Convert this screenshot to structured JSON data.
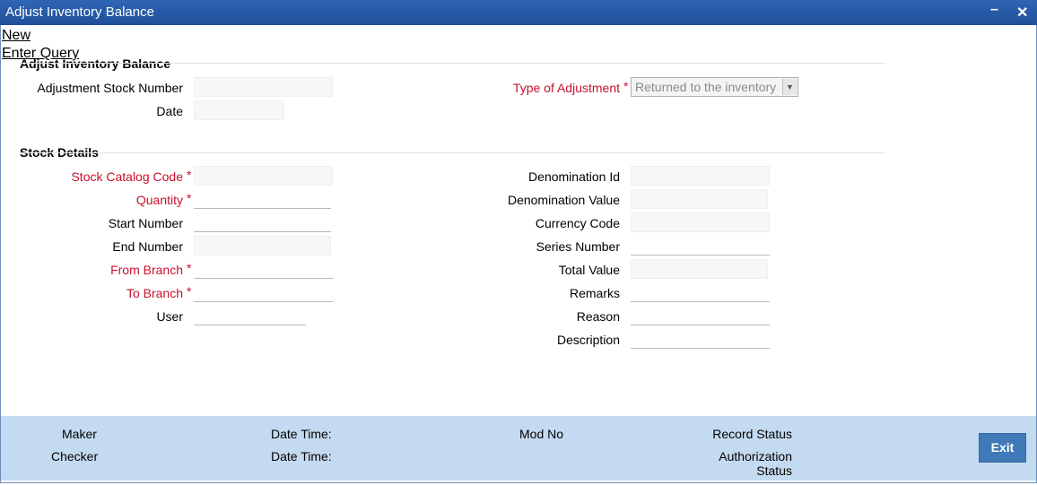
{
  "window": {
    "title": "Adjust Inventory Balance"
  },
  "menu": {
    "new_label": "New",
    "enter_query_label": "Enter Query"
  },
  "header_section": {
    "title": "Adjust Inventory Balance",
    "adjustment_stock_number_label": "Adjustment Stock Number",
    "date_label": "Date",
    "type_of_adjustment_label": "Type of Adjustment",
    "type_of_adjustment_value": "Returned to the inventory",
    "required_marker": "*"
  },
  "stock_details": {
    "title": "Stock Details",
    "left": {
      "stock_catalog_code": "Stock Catalog Code",
      "quantity": "Quantity",
      "start_number": "Start Number",
      "end_number": "End Number",
      "from_branch": "From Branch",
      "to_branch": "To Branch",
      "user": "User"
    },
    "right": {
      "denomination_id": "Denomination Id",
      "denomination_value": "Denomination Value",
      "currency_code": "Currency Code",
      "series_number": "Series Number",
      "total_value": "Total Value",
      "remarks": "Remarks",
      "reason": "Reason",
      "description": "Description"
    }
  },
  "footer": {
    "maker": "Maker",
    "checker": "Checker",
    "date_time_1": "Date Time:",
    "date_time_2": "Date Time:",
    "mod_no": "Mod No",
    "record_status": "Record Status",
    "authorization_status_line1": "Authorization",
    "authorization_status_line2": "Status",
    "exit_label": "Exit"
  },
  "colors": {
    "titlebar": "#2f66b4",
    "required": "#c8102e",
    "footer": "#c4daf0",
    "exit_button": "#3f79b8"
  }
}
